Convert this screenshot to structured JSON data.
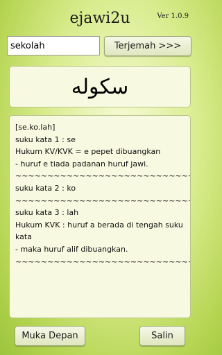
{
  "app": {
    "title": "ejawi2u",
    "version": "Ver 1.0.9"
  },
  "search": {
    "value": "sekolah"
  },
  "buttons": {
    "translate": "Terjemah >>>",
    "home": "Muka Depan",
    "copy": "Salin"
  },
  "result": {
    "jawi": "سکوله",
    "details": [
      "[se.ko.lah]",
      "suku kata 1 : se",
      "Hukum KV/KVK = e pepet dibuangkan",
      "- huruf e tiada padanan huruf jawi.",
      "~~~~~~~~~~~~~~~~~~~~~~~~~~~~~~",
      "suku kata 2 : ko",
      "~~~~~~~~~~~~~~~~~~~~~~~~~~~~~~",
      "suku kata 3 : lah",
      "Hukum KVK : huruf a berada di tengah suku kata",
      "- maka huruf alif dibuangkan.",
      "~~~~~~~~~~~~~~~~~~~~~~~~~~~~~~"
    ]
  }
}
